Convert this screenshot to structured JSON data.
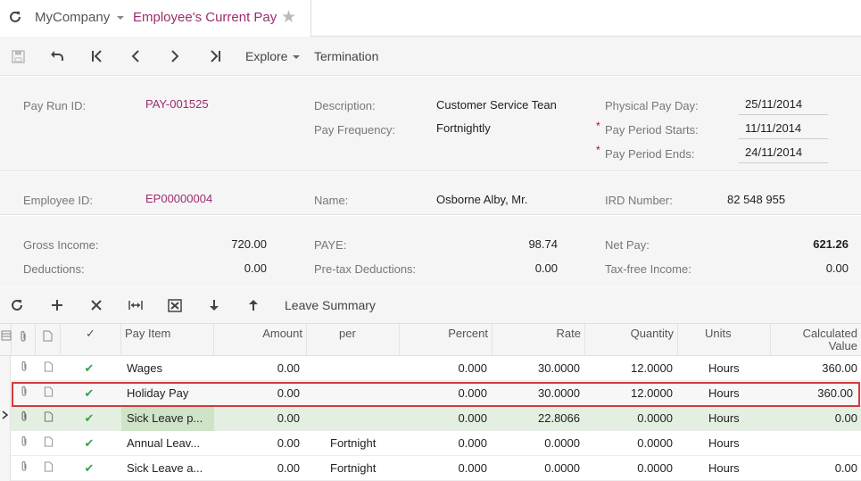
{
  "header": {
    "company": "MyCompany",
    "screen_title": "Employee's Current Pay"
  },
  "toolbar": {
    "explore_label": "Explore",
    "termination_label": "Termination"
  },
  "summary": {
    "pay_run_id_label": "Pay Run ID:",
    "pay_run_id": "PAY-001525",
    "description_label": "Description:",
    "description": "Customer Service Tean",
    "pay_frequency_label": "Pay Frequency:",
    "pay_frequency": "Fortnightly",
    "physical_pay_day_label": "Physical Pay Day:",
    "physical_pay_day": "25/11/2014",
    "pay_period_starts_label": "Pay Period Starts:",
    "pay_period_starts": "11/11/2014",
    "pay_period_ends_label": "Pay Period Ends:",
    "pay_period_ends": "24/11/2014",
    "required_mark": "*"
  },
  "employee": {
    "employee_id_label": "Employee ID:",
    "employee_id": "EP00000004",
    "name_label": "Name:",
    "name": "Osborne Alby, Mr.",
    "ird_label": "IRD Number:",
    "ird": "82 548 955"
  },
  "totals": {
    "gross_income_label": "Gross Income:",
    "gross_income": "720.00",
    "deductions_label": "Deductions:",
    "deductions": "0.00",
    "paye_label": "PAYE:",
    "paye": "98.74",
    "pretax_label": "Pre-tax Deductions:",
    "pretax": "0.00",
    "net_pay_label": "Net Pay:",
    "net_pay": "621.26",
    "taxfree_label": "Tax-free Income:",
    "taxfree": "0.00"
  },
  "grid_toolbar": {
    "leave_summary_label": "Leave Summary"
  },
  "grid": {
    "columns": {
      "pay_item": "Pay Item",
      "amount": "Amount",
      "per": "per",
      "percent": "Percent",
      "rate": "Rate",
      "quantity": "Quantity",
      "units": "Units",
      "calc_line1": "Calculated",
      "calc_line2": "Value"
    },
    "rows": [
      {
        "pay_item": "Wages",
        "amount": "0.00",
        "per": "",
        "percent": "0.000",
        "rate": "30.0000",
        "quantity": "12.0000",
        "units": "Hours",
        "calc": "360.00"
      },
      {
        "pay_item": "Holiday Pay",
        "amount": "0.00",
        "per": "",
        "percent": "0.000",
        "rate": "30.0000",
        "quantity": "12.0000",
        "units": "Hours",
        "calc": "360.00"
      },
      {
        "pay_item": "Sick Leave p...",
        "amount": "0.00",
        "per": "",
        "percent": "0.000",
        "rate": "22.8066",
        "quantity": "0.0000",
        "units": "Hours",
        "calc": "0.00"
      },
      {
        "pay_item": "Annual Leav...",
        "amount": "0.00",
        "per": "Fortnight",
        "percent": "0.000",
        "rate": "0.0000",
        "quantity": "0.0000",
        "units": "Hours",
        "calc": ""
      },
      {
        "pay_item": "Sick Leave a...",
        "amount": "0.00",
        "per": "Fortnight",
        "percent": "0.000",
        "rate": "0.0000",
        "quantity": "0.0000",
        "units": "Hours",
        "calc": "0.00"
      }
    ]
  },
  "colors": {
    "accent": "#9b2d6e",
    "check": "#3aa34a",
    "selection": "#d43b3b"
  }
}
